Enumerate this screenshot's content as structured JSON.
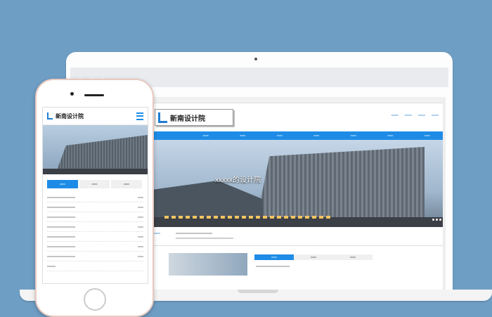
{
  "desktop": {
    "hero_caption": "xxxxx的设计院",
    "header_links": [
      "xxxxx",
      "xxxxx",
      "xxxxx",
      "xxxxx"
    ],
    "nav_items": [
      "",
      "xxxx",
      "xxxx",
      "xxxx",
      "xxxx",
      "xxxx",
      "xxxx",
      "xxxx"
    ],
    "strip_label": "xxxxx",
    "strip_text": "xxxxxxxxxxxxxxxxxxxxxxxxxx",
    "strip_text2": "xxxxxxxxxxxxxxxxxxxxxxxxxxxxxxxxxxxxxxxxx",
    "tabs": [
      "xxxx",
      "xxxx",
      "xxxx"
    ],
    "lower_text": "xxxxxxxxxxxxxxxxxxxxxxxx"
  },
  "mobile": {
    "tabs": [
      "xxxx",
      "xxxx",
      "xxxx"
    ],
    "list": [
      {
        "title": "xxxxxxxxxxxxxxxxxxxx",
        "date": "xxxx"
      },
      {
        "title": "xxxxxxxxxxxxxxxxxxxx",
        "date": "xxxx"
      },
      {
        "title": "xxxxxxxxxxxxxxxxxxxx",
        "date": "xxxx"
      },
      {
        "title": "xxxxxxxxxxxxxxxxxxxx",
        "date": "xxxx"
      },
      {
        "title": "xxxxxxxxxxxxxxxxxxxx",
        "date": "xxxx"
      },
      {
        "title": "xxxxxxxxxxxxxxxxxxxx",
        "date": "xxxx"
      },
      {
        "title": "xxxxxxxxxxxxxxxxxxxx",
        "date": "xxxx"
      },
      {
        "title": "xxxxxx",
        "date": ""
      }
    ]
  },
  "colors": {
    "accent": "#1e8ce6",
    "background": "#6f9ec4"
  }
}
